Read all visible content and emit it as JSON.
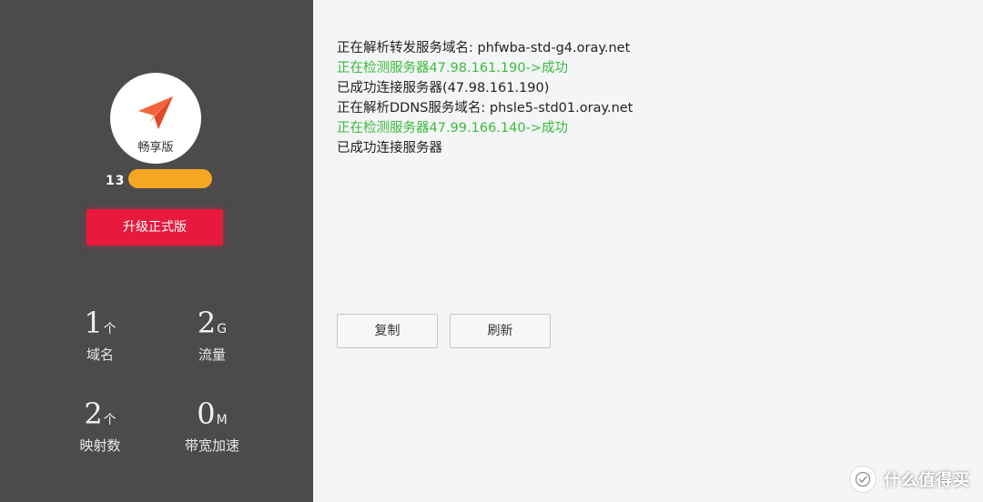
{
  "sidebar": {
    "edition_label": "畅享版",
    "account_prefix": "13",
    "upgrade_label": "升级正式版",
    "stats": [
      {
        "value": "1",
        "unit": "个",
        "label": "域名"
      },
      {
        "value": "2",
        "unit": "G",
        "label": "流量"
      },
      {
        "value": "2",
        "unit": "个",
        "label": "映射数"
      },
      {
        "value": "0",
        "unit": "M",
        "label": "带宽加速"
      }
    ]
  },
  "main": {
    "log": [
      {
        "text": "正在解析转发服务域名: phfwba-std-g4.oray.net",
        "status": "normal"
      },
      {
        "text": "正在检测服务器47.98.161.190->成功",
        "status": "ok"
      },
      {
        "text": "已成功连接服务器(47.98.161.190)",
        "status": "normal"
      },
      {
        "text": "正在解析DDNS服务域名: phsle5-std01.oray.net",
        "status": "normal"
      },
      {
        "text": "正在检测服务器47.99.166.140->成功",
        "status": "ok"
      },
      {
        "text": "已成功连接服务器",
        "status": "normal"
      }
    ],
    "copy_label": "复制",
    "refresh_label": "刷新"
  },
  "watermark": {
    "badge_glyph": "值",
    "text": "什么值得买"
  },
  "colors": {
    "sidebar_bg": "#4b4b4b",
    "accent_red": "#e8193c",
    "plane_orange": "#f0643c",
    "mask_orange": "#f5a623",
    "success_green": "#3cbc3c",
    "main_bg": "#f4f5f7"
  },
  "icons": {
    "logo": "paper-plane-icon",
    "watermark": "smzdm-badge-icon"
  }
}
